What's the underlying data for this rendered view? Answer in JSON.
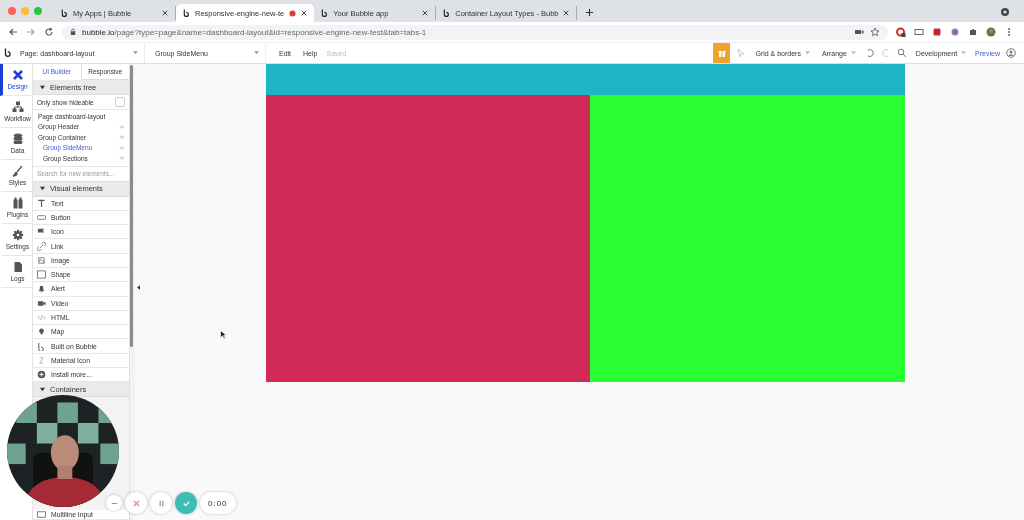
{
  "browser": {
    "tabs": [
      {
        "title": "My Apps | Bubble",
        "selected": false,
        "recording": false
      },
      {
        "title": "Responsive-engine-new-te",
        "selected": true,
        "recording": true
      },
      {
        "title": "Your Bubble app",
        "selected": false,
        "recording": false
      },
      {
        "title": "Container Layout Types - Bubb",
        "selected": false,
        "recording": false
      }
    ],
    "url": {
      "host": "bubble.io",
      "path": "/page?type=page&name=dashboard-layout&id=responsive-engine-new-test&tab=tabs-1"
    }
  },
  "editor": {
    "page_select": "Page: dashboard-layout",
    "element_select": "Group SideMenu",
    "menu": [
      "Edit",
      "Help"
    ],
    "save_status": "Saved",
    "toolbar": [
      "Grid & borders",
      "Arrange"
    ],
    "version": "Development",
    "preview": "Preview"
  },
  "sidebar": {
    "items": [
      {
        "label": "Design",
        "selected": true
      },
      {
        "label": "Workflow",
        "selected": false
      },
      {
        "label": "Data",
        "selected": false
      },
      {
        "label": "Styles",
        "selected": false
      },
      {
        "label": "Plugins",
        "selected": false
      },
      {
        "label": "Settings",
        "selected": false
      },
      {
        "label": "Logs",
        "selected": false
      }
    ]
  },
  "panel": {
    "tabs": [
      {
        "label": "UI Builder",
        "selected": true
      },
      {
        "label": "Responsive",
        "selected": false
      }
    ],
    "elements_tree": {
      "title": "Elements tree",
      "expanded": true,
      "hideable_filter": {
        "label": "Only show hideable",
        "checked": false
      },
      "items": [
        {
          "label": "Page dashboard-layout",
          "selected": false
        },
        {
          "label": "Group Header",
          "selected": false
        },
        {
          "label": "Group Container",
          "selected": false,
          "children": [
            {
              "label": "Group SideMenu",
              "selected": true
            },
            {
              "label": "Group Sections",
              "selected": false
            }
          ]
        }
      ]
    },
    "search": {
      "placeholder": "Search for new elements..."
    },
    "visual_elements": {
      "title": "Visual elements",
      "expanded": true,
      "items": [
        "Text",
        "Button",
        "Icon",
        "Link",
        "Image",
        "Shape",
        "Alert",
        "Video",
        "HTML",
        "Map",
        "Built on Bubble",
        "Material Icon",
        "Install more..."
      ]
    },
    "containers": {
      "title": "Containers",
      "expanded": true,
      "items": [
        "Multiline Input"
      ]
    }
  },
  "canvas": {
    "columns": [
      {
        "color": "#d22a56"
      },
      {
        "color": "#2bff33"
      }
    ]
  },
  "recorder": {
    "timer": "0:00"
  }
}
